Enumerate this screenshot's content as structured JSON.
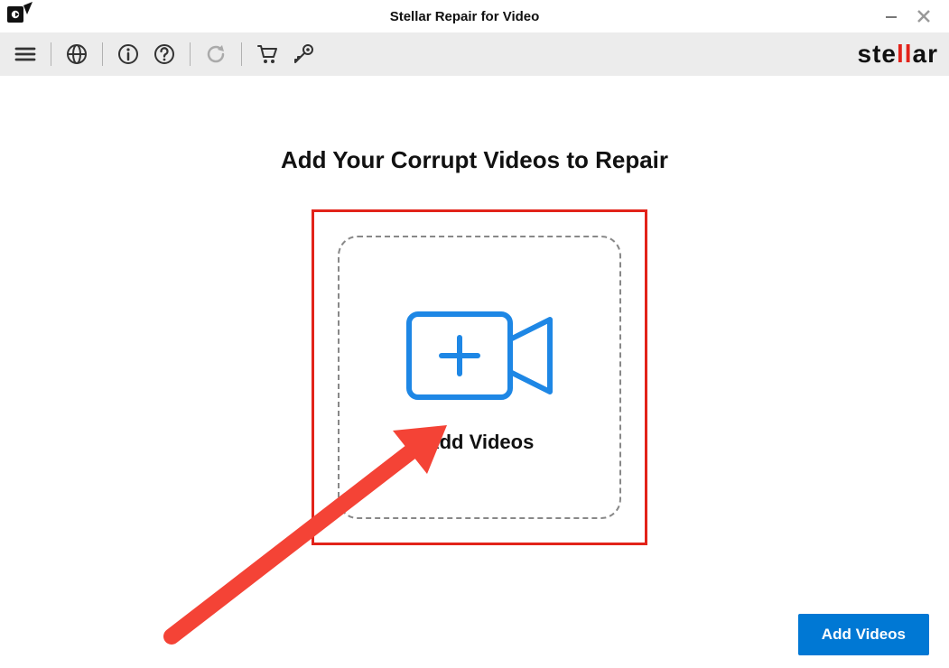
{
  "window": {
    "title": "Stellar Repair for Video"
  },
  "brand": {
    "pre": "ste",
    "accent": "ll",
    "post": "ar"
  },
  "toolbar": {
    "menu_label": "menu",
    "language_label": "language",
    "info_label": "info",
    "help_label": "help",
    "refresh_label": "refresh",
    "cart_label": "cart",
    "activate_label": "activate"
  },
  "main": {
    "heading": "Add Your Corrupt Videos to Repair",
    "dropzone_label": "Add Videos",
    "primary_button": "Add Videos"
  }
}
